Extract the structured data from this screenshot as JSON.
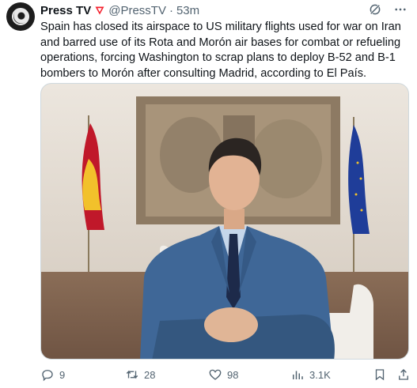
{
  "tweet": {
    "author_name": "Press TV",
    "author_handle": "@PressTV",
    "separator": "·",
    "time": "53m",
    "text": "Spain has closed its airspace to US military flights used for war on Iran and barred use of its Rota and Morón air bases for combat or refueling operations, forcing Washington to scrap plans to deploy B-52 and B-1 bombers to Morón after consulting Madrid, according to El País."
  },
  "actions": {
    "replies": "9",
    "reposts": "28",
    "likes": "98",
    "views": "3.1K"
  },
  "colors": {
    "text": "#0f1419",
    "muted": "#536471",
    "badge": "#f4212e"
  }
}
